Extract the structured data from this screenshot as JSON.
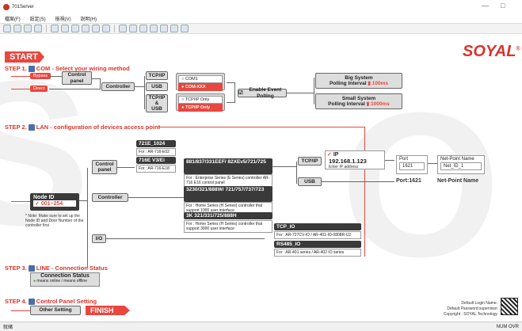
{
  "window": {
    "title": "701Server",
    "minimize": "—",
    "maximize": "□"
  },
  "menu": {
    "items": [
      "檔案(F)",
      "設定(S)",
      "檢視(V)",
      "說明(H)"
    ]
  },
  "brand": {
    "logo": "SOYAL",
    "mark": "®"
  },
  "start": {
    "label": "START"
  },
  "step1": {
    "label": "STEP 1.",
    "title": "COM - Select your wiring method"
  },
  "step1_items": {
    "bypass": "Bypass",
    "direct": "Direct",
    "control_panel": "Control panel",
    "controller": "Controller",
    "tcpip": "TCP/IP",
    "usb": "USB",
    "tcpip2": "TCP/IP",
    "amp": "&",
    "usb2": "USB",
    "com1": "COM1",
    "comxxx": "COM-XXX",
    "tcponly_opt": "TCP/IP Only",
    "tcponly": "TCP/IP Only",
    "enable_polling": "Enable Event Polling",
    "big_system": "Big System",
    "big_polling": "Polling Interval",
    "big_ms": "100ms",
    "small_system": "Small System",
    "small_polling": "Polling Interval",
    "small_ms": "1000ms"
  },
  "step2": {
    "label": "STEP 2.",
    "title": "LAN - configuration of devices access point"
  },
  "step2_items": {
    "node_id": "Node ID",
    "node_range": "001~254",
    "note": "* Note: Make sure to set up the Node ID and Door Number of the controller first",
    "control_panel": "Control panel",
    "controller": "Controller",
    "io": "I/O",
    "m1_title": "721E_1024",
    "m1_sub": "For : AR-716-E02",
    "m2_title": "716E V3/Ei",
    "m2_sub": "For : AR-716-E18",
    "m3_title": "881/837/331EEF/ 82XEv5/721/725",
    "m3_sub": "For : Enterprise Series (E Series) controller AR-716 E16 control panel",
    "m4_title": "3230/321/888W/ 721/757/737/723",
    "m4_sub": "For : Home Series (H Series) controller that support 1000 user interface",
    "m5_title": "3K 321/331/725/888H",
    "m5_sub": "For : Home Series (H Series) controller that support 3000 user interface",
    "tcpio_title": "TCP_IO",
    "tcpio_sub": "For : AR-727CV-IO / AR-401-IO-0808R-U2",
    "rs485_title": "RS485_IO",
    "rs485_sub": "For : AR-401 series / AR-402 IO series",
    "tcpip": "TCP/IP",
    "usb": "USB",
    "ip_label": "IP",
    "ip_value": "192.168.1.123",
    "ip_hint": "Enter IP address",
    "port_label": "Port",
    "port_value": "1621",
    "port_text": "Port:1621",
    "np_label": "Net-Point Name",
    "np_value": "Net_ID_1",
    "np_text": "Net-Point Name"
  },
  "step3": {
    "label": "STEP 3.",
    "title": "LINE - Connection Status",
    "box_title": "Connection Status",
    "legend": "means online / means offline"
  },
  "step4": {
    "label": "STEP 4.",
    "title": "Control Panel Setting",
    "other": "Other Setting",
    "finish": "FINISH"
  },
  "footer": {
    "login": "Default Login Name:",
    "password": "Default Password:supervisor",
    "copyright": "Copyright : SOYAL Technology"
  },
  "status": {
    "left": "就緒",
    "right": "NUM OVR"
  }
}
